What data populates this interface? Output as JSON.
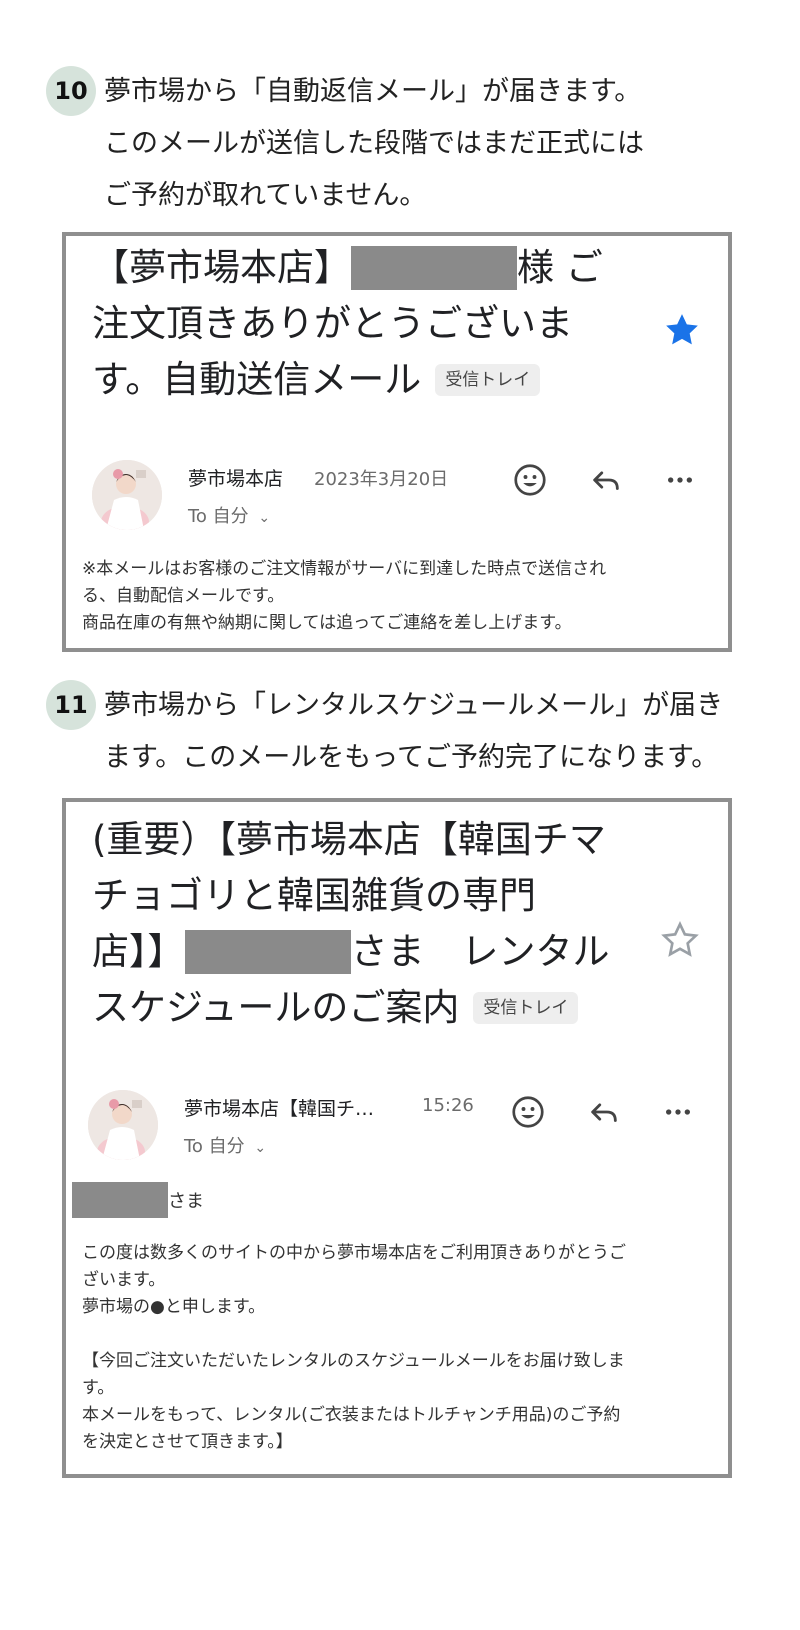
{
  "steps": [
    {
      "number": "10",
      "lines": [
        "夢市場から「自動返信メール」が届きます。",
        "このメールが送信した段階ではまだ正式には",
        "ご予約が取れていません。"
      ]
    },
    {
      "number": "11",
      "lines": [
        "夢市場から「レンタルスケジュールメール」が届き",
        "ます。このメールをもってご予約完了になります。"
      ]
    }
  ],
  "email1": {
    "subject_line1_prefix": "【夢市場本店】",
    "subject_line1_suffix": "様 ご",
    "subject_line2": "注文頂きありがとうございま",
    "subject_line3": "す。自動送信メール",
    "label": "受信トレイ",
    "starred": true,
    "sender": "夢市場本店",
    "date": "2023年3月20日",
    "to": "To 自分",
    "body": [
      "※本メールはお客様のご注文情報がサーバに到達した時点で送信され",
      "る、自動配信メールです。",
      "商品在庫の有無や納期に関しては追ってご連絡を差し上げます。"
    ]
  },
  "email2": {
    "subject_line1": "(重要）【夢市場本店【韓国チマ",
    "subject_line2": "チョゴリと韓国雑貨の専門",
    "subject_line3_prefix": "店】】",
    "subject_line3_suffix": "さま　レンタル",
    "subject_line4": "スケジュールのご案内",
    "label": "受信トレイ",
    "starred": false,
    "sender": "夢市場本店【韓国チ…",
    "time": "15:26",
    "to": "To 自分",
    "greeting_suffix": "さま",
    "body": [
      "この度は数多くのサイトの中から夢市場本店をご利用頂きありがとうご",
      "ざいます。",
      "夢市場の●と申します。",
      "",
      "【今回ご注文いただいたレンタルのスケジュールメールをお届け致しま",
      "す。",
      "本メールをもって、レンタル(ご衣装またはトルチャンチ用品)のご予約",
      "を決定とさせて頂きます。】"
    ]
  },
  "colors": {
    "star_filled": "#1a73e8",
    "star_outline": "#9aa0a6",
    "badge_bg": "#d6e3db",
    "redaction": "#8a8a8a",
    "card_border": "#8f8f8f"
  },
  "icons": [
    "emoji-icon",
    "reply-icon",
    "more-icon",
    "star-icon",
    "chevron-down-icon"
  ]
}
